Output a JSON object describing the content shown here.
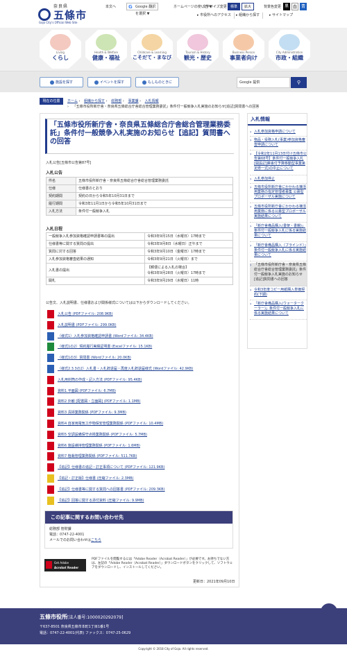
{
  "header": {
    "pref": "奈良県",
    "city": "五條市",
    "city_en": "Gojo City's Official Web Site",
    "links": [
      "本文へ",
      "Google 翻訳を選択",
      "ホームページの使い方 ▼",
      "サイトマップ"
    ],
    "links_top": [
      "本文へ",
      "翻訳を選択",
      "ホーム",
      "所在地・お問い合わせ"
    ],
    "text_size_label": "文字サイズ変更",
    "std": "標準",
    "big": "拡大",
    "bg_label": "背景色変更",
    "bg_options": [
      "黒",
      "白",
      "青"
    ],
    "sub_links": [
      "市役所へのアクセス",
      "組織から探す",
      "サイトマップ"
    ]
  },
  "nav": [
    {
      "en": "Living",
      "jp": "くらし",
      "color": "#e08a7a"
    },
    {
      "en": "Health & Welfare",
      "jp": "健康・福祉",
      "color": "#8fc25c"
    },
    {
      "en": "Childcare & Learning",
      "jp": "こそだて・まなび",
      "color": "#e8a23c"
    },
    {
      "en": "Tourism & History",
      "jp": "観光・歴史",
      "color": "#d77aa8"
    },
    {
      "en": "Business Person",
      "jp": "事業者向け",
      "color": "#e8894a"
    },
    {
      "en": "City Administration",
      "jp": "市政・組織",
      "color": "#6aaad8"
    }
  ],
  "quick": [
    "施設を探す",
    "イベントを探す",
    "もしものときに"
  ],
  "search": {
    "placeholder": "Google 提供",
    "button": "検索"
  },
  "breadcrumb": {
    "label": "現在の位置",
    "trail": [
      "ホーム",
      "組織から探す",
      "総務部",
      "事業課",
      "入札情報"
    ],
    "current": "「五條市役所新庁舎・奈良県五條総合庁舎総合管理業務委託」条件付一般競争入札実施のお知らせ[追記]質問書への回答"
  },
  "article": {
    "title": "「五條市役所新庁舎・奈良県五條総合庁舎総合管理業務委託」条件付一般競争入札実施のお知らせ【追記】質問書への回答",
    "notice_no": "入札公告[五條市公告第87号]",
    "sec1": "入札公告",
    "table1": [
      [
        "件名",
        "五條市役所新庁舎・奈良県五條総合庁舎総合管理業務委託"
      ],
      [
        "仕様",
        "仕様書のとおり"
      ],
      [
        "契約期間",
        "契約の日から令和5年10月31日まで"
      ],
      [
        "履行期間",
        "令和3年11月1日から令和5年10月31日まで"
      ],
      [
        "入札方法",
        "条件付一般競争入札"
      ]
    ],
    "sec2": "入札日程",
    "table2": [
      [
        "一般競争入札参加資格確認申請書等の提出",
        "令和3年9月15日（水曜日）17時まで"
      ],
      [
        "仕様書等に関する質問の提出",
        "令和3年9月8日（水曜日）正午まで"
      ],
      [
        "質問に対する回答",
        "令和3年9月10日（金曜日）17時まで"
      ],
      [
        "入札参加資格審査結果の通知",
        "令和3年9月21日（火曜日）まで"
      ],
      [
        "入札書の提出",
        "【郵便による入札の場合】\n令和3年9月28日（火曜日）17時まで"
      ],
      [
        "開札",
        "令和3年9月29日（水曜日）11時"
      ]
    ],
    "dl_intro": "公告文、入札説明書、仕様書および関係様式については以下からダウンロードしてください。",
    "downloads": [
      {
        "t": "入札公告 (PDFファイル: 208.9KB)",
        "c": "#d0021b"
      },
      {
        "t": "入札説明書 (PDFファイル: 299.0KB)",
        "c": "#d0021b"
      },
      {
        "t": "（様式1）入札参加資格確認申請書 (Wordファイル: 34.4KB)",
        "c": "#2b5fb3"
      },
      {
        "t": "（様式1の2）契約履行実績証明書 (Excelファイル: 15.1KB)",
        "c": "#1e8a3c"
      },
      {
        "t": "（様式1の3）質問書 (Wordファイル: 20.0KB)",
        "c": "#2b5fb3"
      },
      {
        "t": "（様式2.3.3の2）入札書・入札辞退届・再度入札辞退届様式 (Wordファイル: 42.9KB)",
        "c": "#2b5fb3"
      },
      {
        "t": "入札用封筒の作成・記入方法 (PDFファイル: 95.4KB)",
        "c": "#d0021b"
      },
      {
        "t": "資料1 平面図 (PDFファイル: 6.7MB)",
        "c": "#d0021b"
      },
      {
        "t": "資料2 外観 [配置図・立面図] (PDFファイル: 1.1MB)",
        "c": "#d0021b"
      },
      {
        "t": "資料3 清掃業務関係 (PDFファイル: 9.3MB)",
        "c": "#d0021b"
      },
      {
        "t": "資料4 自家用電気工作物保安管理業務関係 (PDFファイル: 10.4MB)",
        "c": "#d0021b"
      },
      {
        "t": "資料5 空調設備保守点検業務関係 (PDFファイル: 5.7MB)",
        "c": "#d0021b"
      },
      {
        "t": "資料6 施設維持管理業務関係 (PDFファイル: 1.6MB)",
        "c": "#d0021b"
      },
      {
        "t": "資料7 植栽管理業務関係 (PDFファイル: 511.7KB)",
        "c": "#d0021b"
      },
      {
        "t": "【追記】仕様書の追記・訂正事項について (PDFファイル: 121.9KB)",
        "c": "#d0021b"
      },
      {
        "t": "【追記・訂正版】仕様書 (圧縮ファイル: 2.3MB)",
        "c": "#e8c020"
      },
      {
        "t": "【追記】仕様書等に関する質問への回答書 (PDFファイル: 209.3KB)",
        "c": "#d0021b"
      },
      {
        "t": "【追記】回答に関する添付資料 (圧縮ファイル: 9.9MB)",
        "c": "#e8c020"
      }
    ],
    "contact": {
      "heading": "この記事に関するお問い合わせ先",
      "dept": "総務部 管財課",
      "tel": "電話：0747-22-4001",
      "mail_prefix": "メールでのお問い合わせは",
      "mail_link": "こちら"
    },
    "adobe": {
      "logo1": "Get Adobe",
      "logo2": "Acrobat Reader",
      "text": "PDFファイルを閲覧するには「Adobe Reader（Acrobat Reader）」が必要です。お持ちでない方は、左記の「Adobe Reader（Acrobat Reader）」ダウンロードボタンをクリックして、ソフトウェアをダウンロードし、インストールしてください。"
    },
    "updated": "更新日：2021年09月10日"
  },
  "sidebar": {
    "heading": "入札情報",
    "items": [
      "入札参加資格申請について",
      "物品・役務入札(事業)参加資格審査申請について",
      "【令和2年11月13日付け五條市公告第68号】条件付一般競争入札[開設記]庫舎付予算移動型事業第定修一式)の中止について",
      "入札参加停止",
      "五條市役所新庁舎にかかわる棟活用業務の指定管理者募集 公募型プロポーザル実施について",
      "五條市役所新庁舎にかかわる棟活用業務に係る公募型プロポーザル実施結果について",
      "「新庁舎備品購入(書架・書棚)」条件付一般競争入札に係る実施結果について",
      "「新庁舎備品購入（ブラインド）」条件付一般競争入札に係る実施結果について",
      "「五條市役所新庁舎・奈良県五條総合庁舎総合管理業務委託」条件付一般競争入札実施のお知らせ[追記]質問書への回答",
      "令和3年度コピー用紙購入単価契約(下期)",
      "「新庁舎備品購入(ウォータークーラー)」条件付一般競争入札に係る実施結果について"
    ]
  },
  "footer": {
    "name": "五條市役所",
    "corp": "[法人番号:1000020292079]",
    "addr": "〒637-8501 奈良県五條市本町1丁目1番1号",
    "tel": "電話：0747-22-4001(代表) ファックス：0747-25-0629",
    "copyright": "Copyright © 2018 City of Gojo. All rights reserved.",
    "totop": "▲"
  }
}
